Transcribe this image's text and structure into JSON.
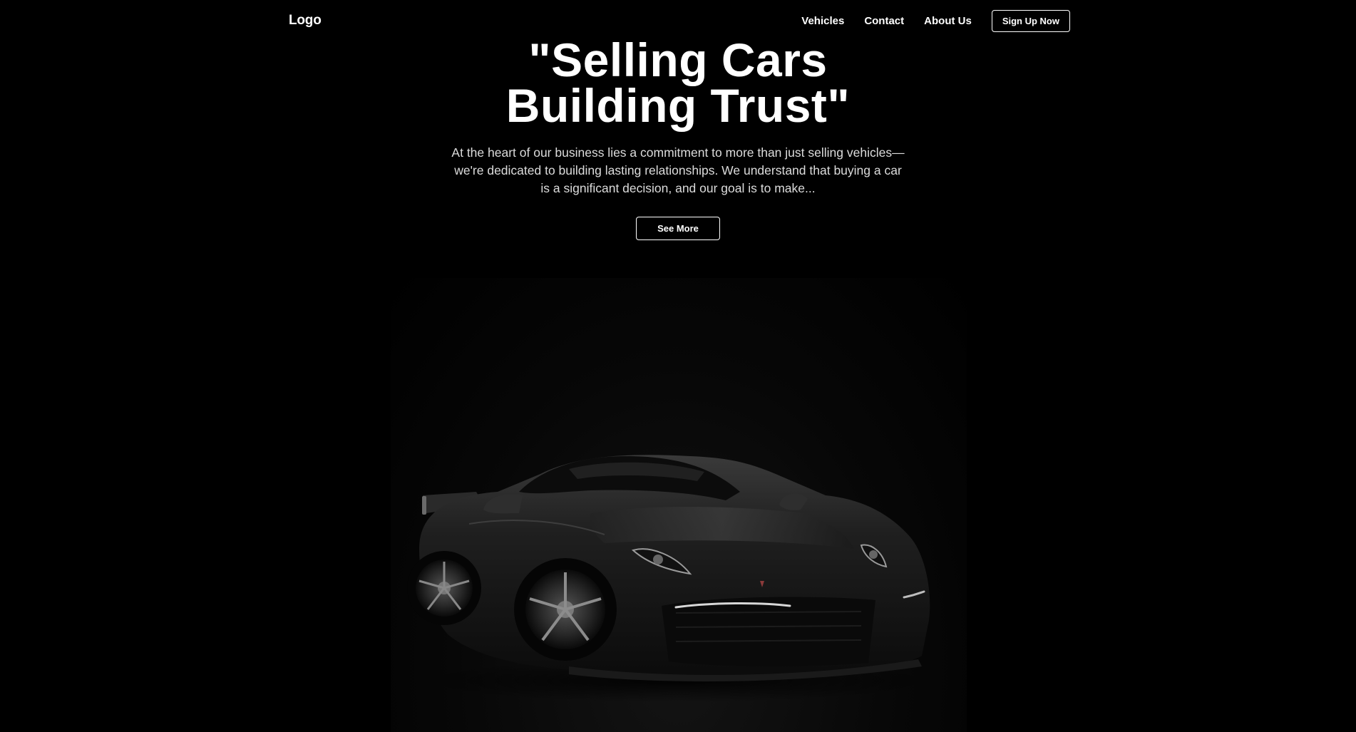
{
  "nav": {
    "logo": "Logo",
    "links": [
      "Vehicles",
      "Contact",
      "About Us"
    ],
    "signup_label": "Sign Up Now"
  },
  "hero": {
    "title_line1": "\"Selling Cars",
    "title_line2": "Building Trust\"",
    "description_line1": "At the heart of our business lies a commitment to more than just selling vehicles—",
    "description_line2": "we're dedicated to building lasting relationships. We understand that buying a car",
    "description_line3": "is a significant decision, and our goal is to make...",
    "cta_label": "See More"
  },
  "colors": {
    "background": "#000000",
    "text": "#ffffff",
    "muted_text": "#dcdcdc",
    "car_body": "#1b1b1b"
  },
  "icons": {
    "car_image": "black-sports-car-image"
  }
}
